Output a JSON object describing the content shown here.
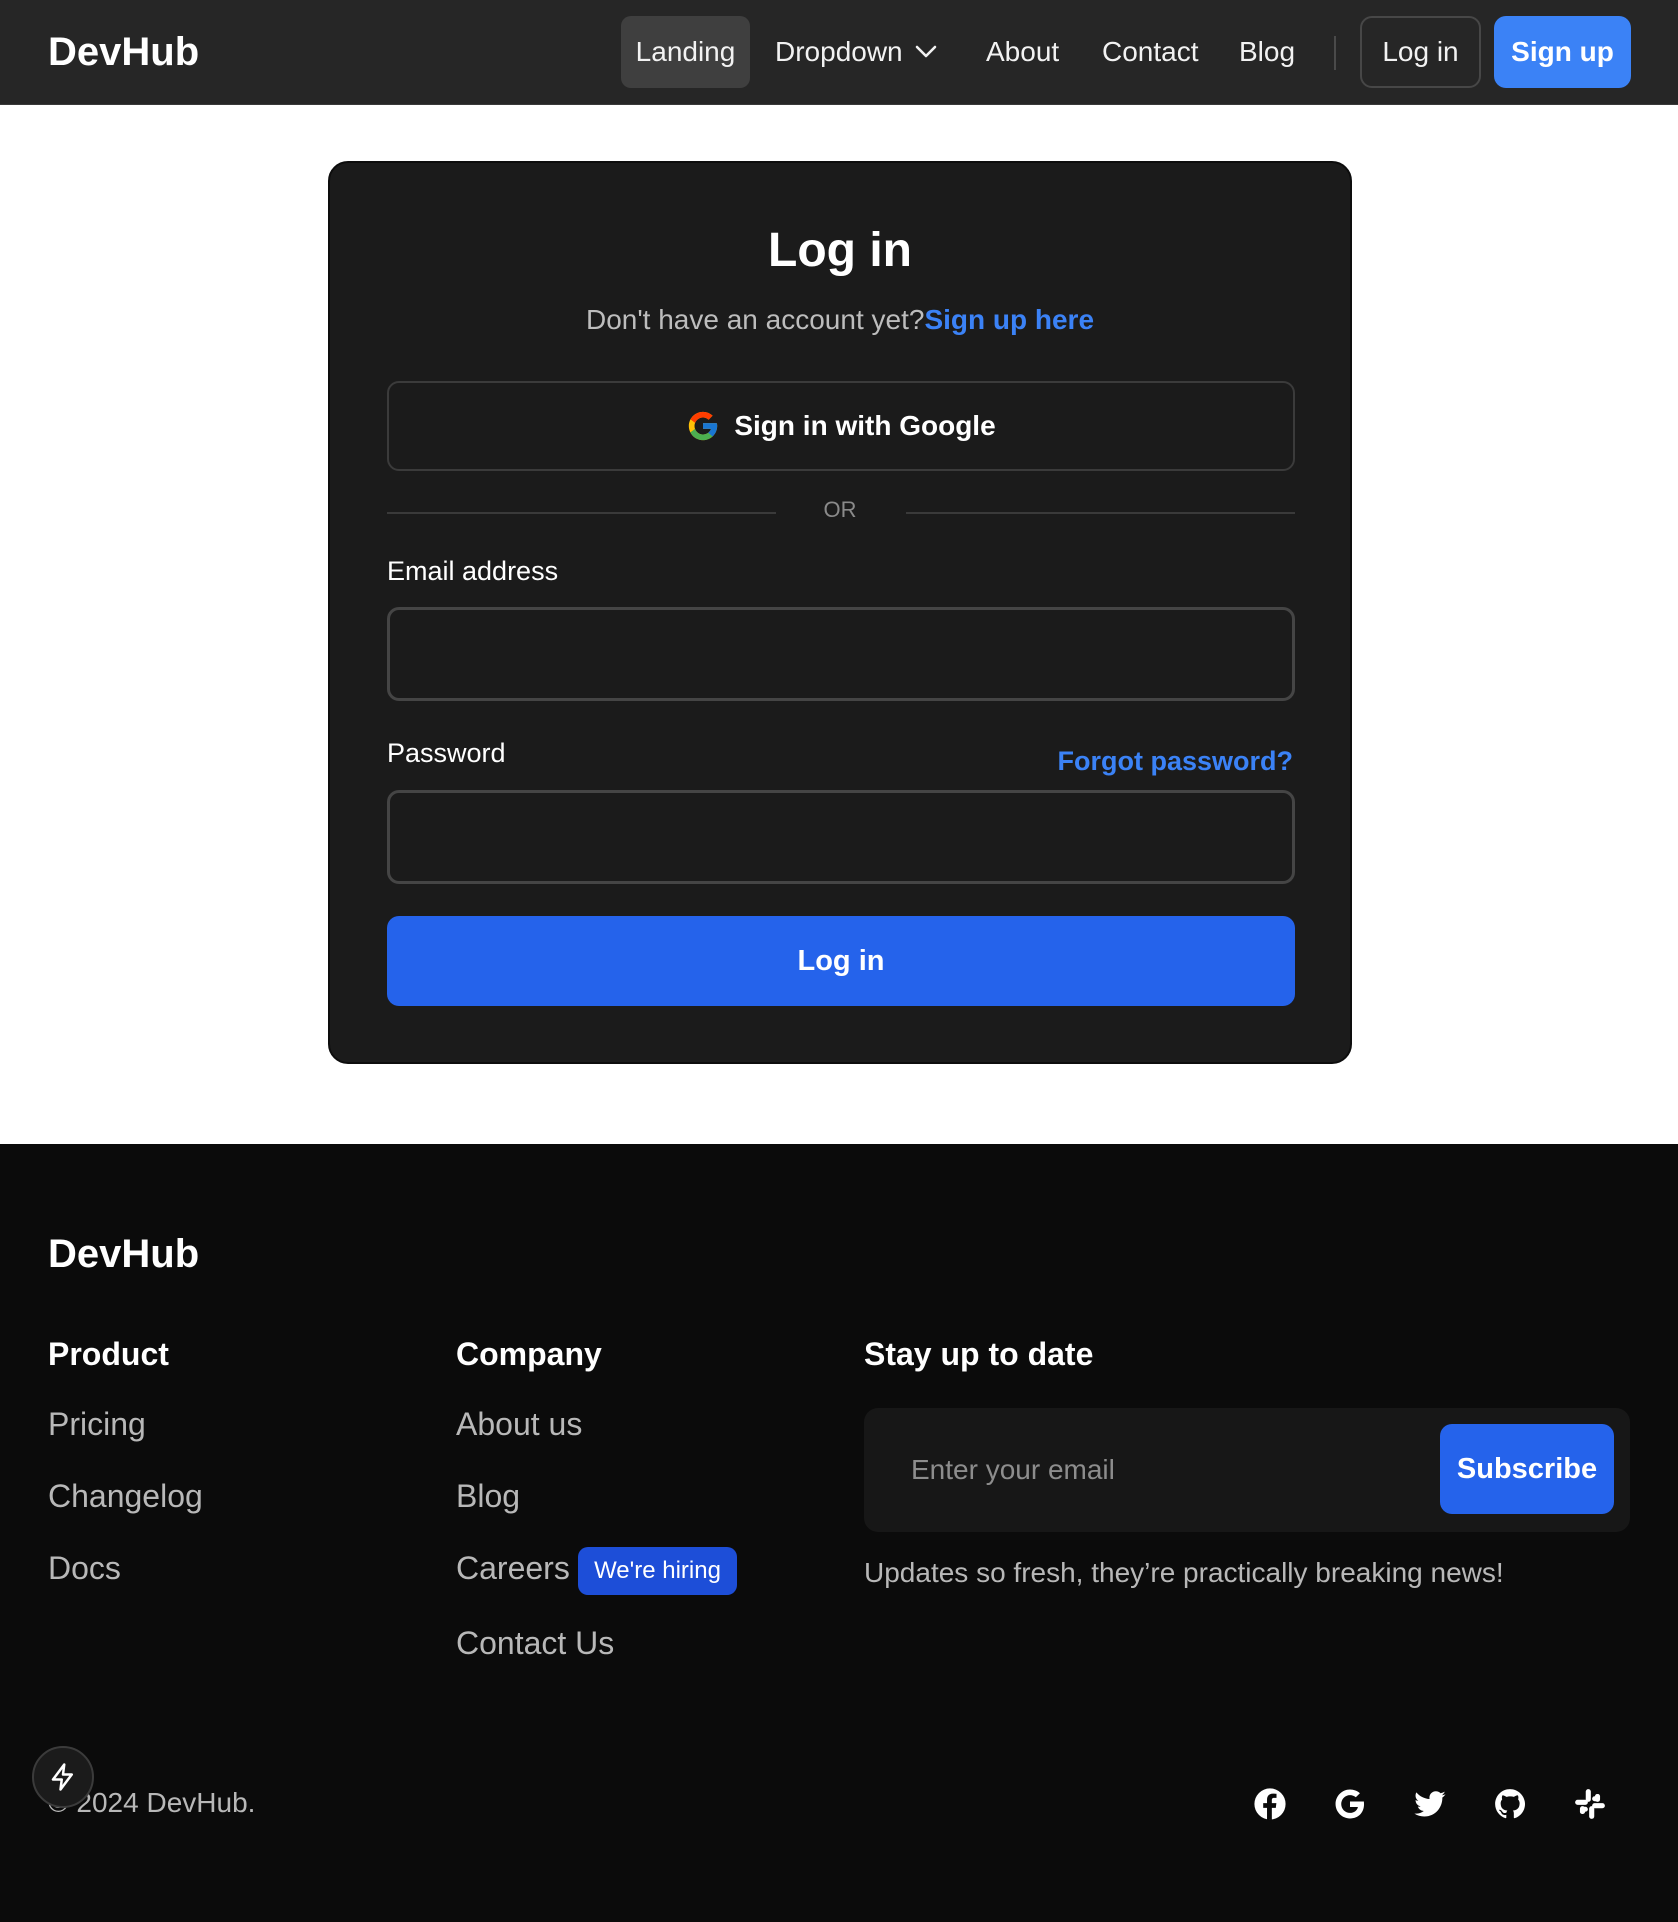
{
  "navbar": {
    "brand": "DevHub",
    "links": [
      "Landing",
      "Dropdown",
      "About",
      "Contact",
      "Blog"
    ],
    "login_label": "Log in",
    "signup_label": "Sign up"
  },
  "login_card": {
    "title": "Log in",
    "subtitle": "Don't have an account yet?",
    "signup_link": "Sign up here",
    "google_button": "Sign in with Google",
    "divider_text": "OR",
    "email_label": "Email address",
    "email_value": "",
    "password_label": "Password",
    "password_value": "",
    "forgot_link": "Forgot password?",
    "submit_label": "Log in"
  },
  "footer": {
    "brand": "DevHub",
    "product": {
      "title": "Product",
      "links": [
        "Pricing",
        "Changelog",
        "Docs"
      ]
    },
    "company": {
      "title": "Company",
      "links": [
        "About us",
        "Blog",
        "Careers",
        "Contact Us"
      ],
      "hiring_badge": "We're hiring"
    },
    "newsletter": {
      "title": "Stay up to date",
      "email_placeholder": "Enter your email",
      "subscribe_label": "Subscribe",
      "tagline": "Updates so fresh, they’re practically breaking news!"
    },
    "copyright": "© 2024 DevHub.",
    "social_icons": [
      "facebook-icon",
      "google-icon",
      "twitter-icon",
      "github-icon",
      "slack-icon"
    ]
  },
  "colors": {
    "accent": "#3b82f6",
    "primary_button": "#2563eb",
    "navbar_bg": "#262626",
    "card_bg": "#1b1b1b",
    "footer_bg": "#0b0b0b"
  }
}
